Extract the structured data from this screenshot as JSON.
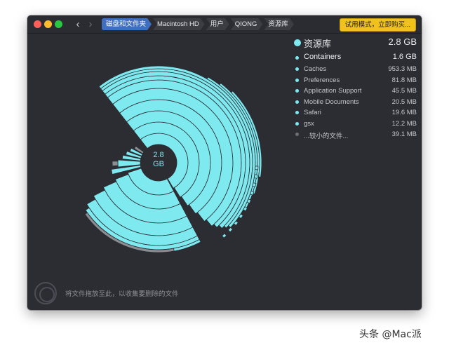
{
  "window": {
    "nav": {
      "back": "‹",
      "forward": "›"
    },
    "breadcrumbs": [
      "磁盘和文件夹",
      "Macintosh HD",
      "用户",
      "QIONG",
      "资源库"
    ],
    "trial_button": "试用模式，立即购买..."
  },
  "chart": {
    "center_value": "2.8",
    "center_unit": "GB"
  },
  "legend": {
    "title": "资源库",
    "total": "2.8 GB",
    "items": [
      {
        "name": "Containers",
        "size": "1.6 GB"
      },
      {
        "name": "Caches",
        "size": "953.3 MB"
      },
      {
        "name": "Preferences",
        "size": "81.8 MB"
      },
      {
        "name": "Application Support",
        "size": "45.5 MB"
      },
      {
        "name": "Mobile Documents",
        "size": "20.5 MB"
      },
      {
        "name": "Safari",
        "size": "19.6 MB"
      },
      {
        "name": "gsx",
        "size": "12.2 MB"
      },
      {
        "name": "...较小的文件...",
        "size": "39.1 MB"
      }
    ]
  },
  "footer": {
    "drop_hint": "将文件拖放至此，以收集要删除的文件"
  },
  "watermark": "头条 @Mac派",
  "colors": {
    "accent": "#7fe9f0",
    "background": "#2b2d33",
    "trial": "#f2c11d"
  }
}
